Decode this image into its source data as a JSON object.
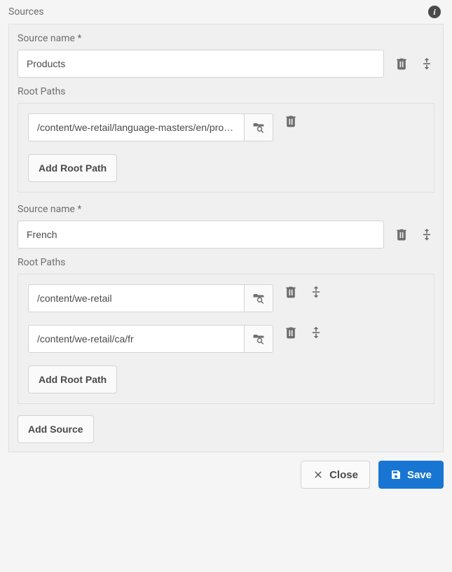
{
  "panel": {
    "title": "Sources",
    "info_tooltip": "i"
  },
  "sources": [
    {
      "name_label": "Source name *",
      "name_value": "Products",
      "paths_label": "Root Paths",
      "paths": [
        {
          "value": "/content/we-retail/language-masters/en/products",
          "show_reorder": false
        }
      ],
      "add_path_label": "Add Root Path",
      "show_reorder": true
    },
    {
      "name_label": "Source name *",
      "name_value": "French",
      "paths_label": "Root Paths",
      "paths": [
        {
          "value": "/content/we-retail",
          "show_reorder": true
        },
        {
          "value": "/content/we-retail/ca/fr",
          "show_reorder": true
        }
      ],
      "add_path_label": "Add Root Path",
      "show_reorder": true
    }
  ],
  "add_source_label": "Add Source",
  "footer": {
    "close_label": "Close",
    "save_label": "Save"
  }
}
